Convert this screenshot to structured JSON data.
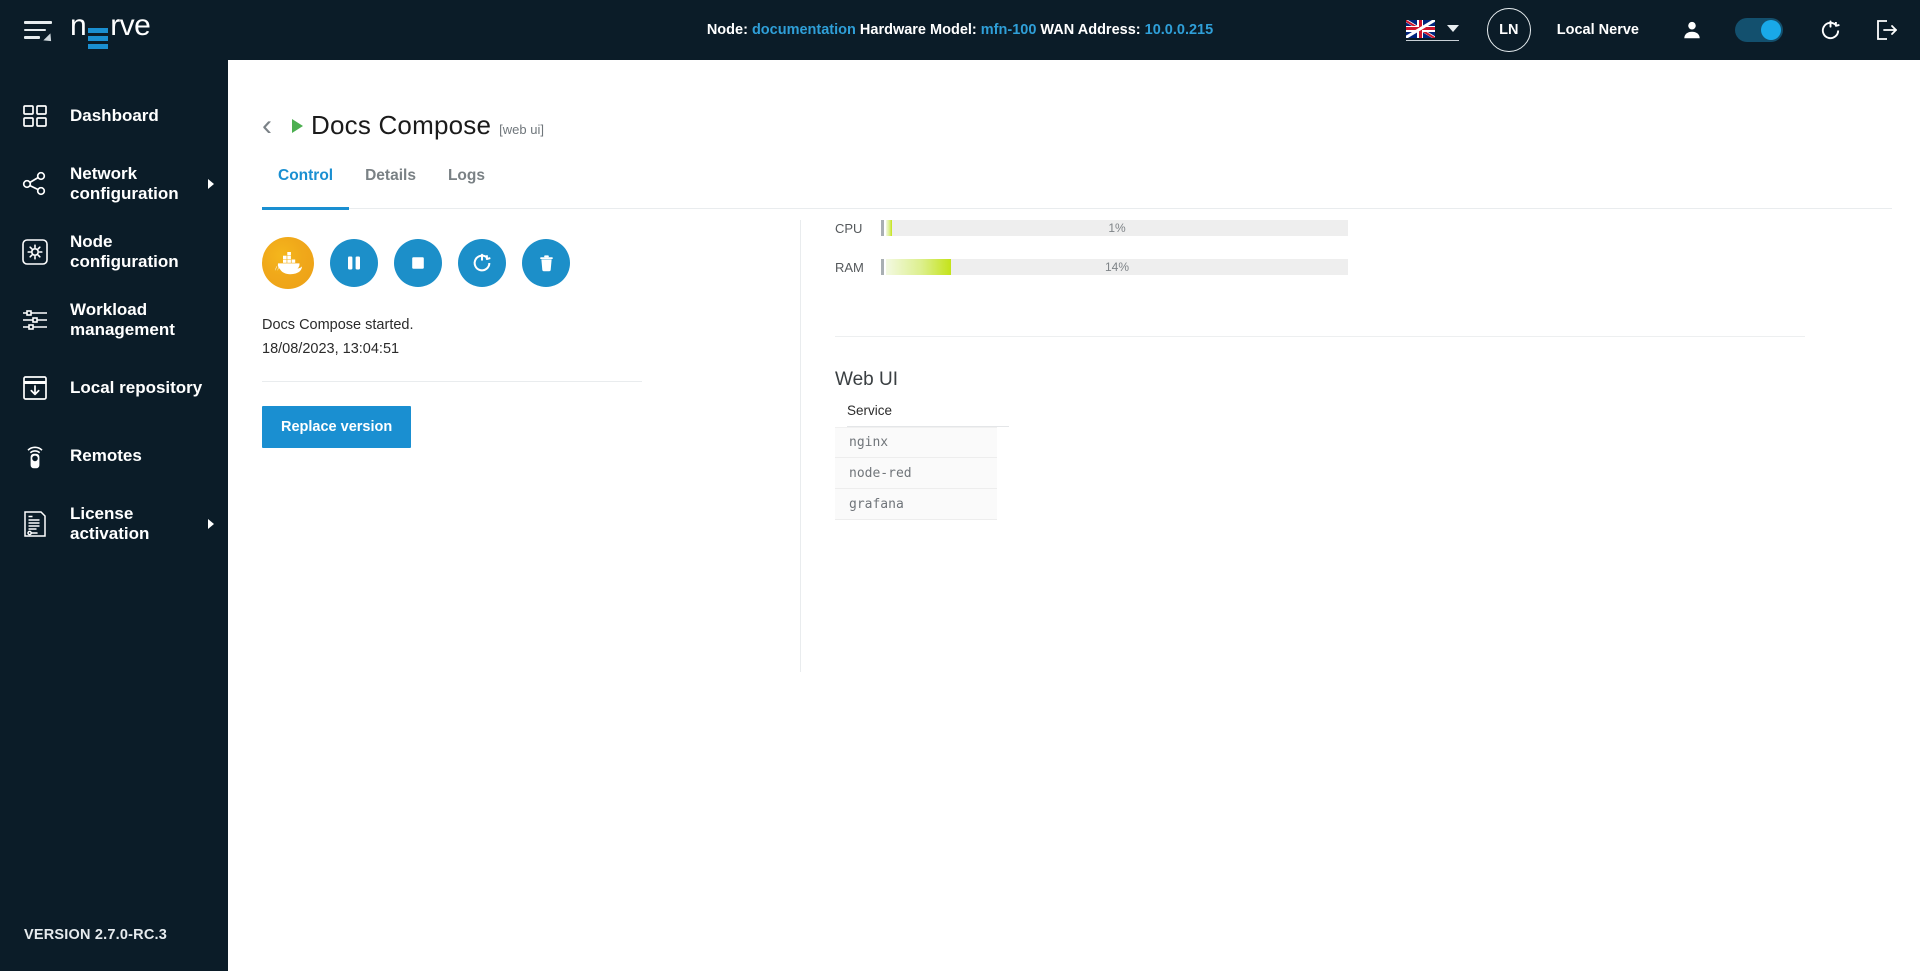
{
  "topbar": {
    "logo_text_left": "n",
    "logo_text_right": "rve",
    "node_label": "Node:",
    "node_value": "documentation",
    "hardware_label": "Hardware Model:",
    "hardware_value": "mfn-100",
    "wan_label": "WAN Address:",
    "wan_value": "10.0.0.215",
    "avatar_initials": "LN",
    "username": "Local Nerve",
    "language": "en-GB",
    "accent_color": "#1a8fd1"
  },
  "sidebar": {
    "items": [
      {
        "label": "Dashboard",
        "icon": "dashboard-icon",
        "has_submenu": false
      },
      {
        "label": "Network configuration",
        "icon": "network-icon",
        "has_submenu": true
      },
      {
        "label": "Node configuration",
        "icon": "node-config-icon",
        "has_submenu": false
      },
      {
        "label": "Workload management",
        "icon": "sliders-icon",
        "has_submenu": false
      },
      {
        "label": "Local repository",
        "icon": "repository-icon",
        "has_submenu": false
      },
      {
        "label": "Remotes",
        "icon": "remote-icon",
        "has_submenu": false
      },
      {
        "label": "License activation",
        "icon": "license-icon",
        "has_submenu": true
      }
    ],
    "version": "VERSION 2.7.0-RC.3"
  },
  "page": {
    "title": "Docs Compose",
    "subtitle": "[web ui]",
    "tabs": [
      {
        "label": "Control",
        "active": true
      },
      {
        "label": "Details",
        "active": false
      },
      {
        "label": "Logs",
        "active": false
      }
    ]
  },
  "control": {
    "buttons": [
      {
        "name": "docker-icon",
        "label": "Docker"
      },
      {
        "name": "pause-button",
        "label": "Pause"
      },
      {
        "name": "stop-button",
        "label": "Stop"
      },
      {
        "name": "restart-button",
        "label": "Restart"
      },
      {
        "name": "delete-button",
        "label": "Delete"
      }
    ],
    "status_text": "Docs Compose started.",
    "status_time": "18/08/2023, 13:04:51",
    "replace_version_label": "Replace version"
  },
  "metrics": {
    "cpu": {
      "label": "CPU",
      "percent_text": "1%",
      "percent": 1
    },
    "ram": {
      "label": "RAM",
      "percent_text": "14%",
      "percent": 14
    }
  },
  "webui": {
    "title": "Web UI",
    "column_header": "Service",
    "services": [
      {
        "name": "nginx"
      },
      {
        "name": "node-red"
      },
      {
        "name": "grafana"
      }
    ]
  }
}
